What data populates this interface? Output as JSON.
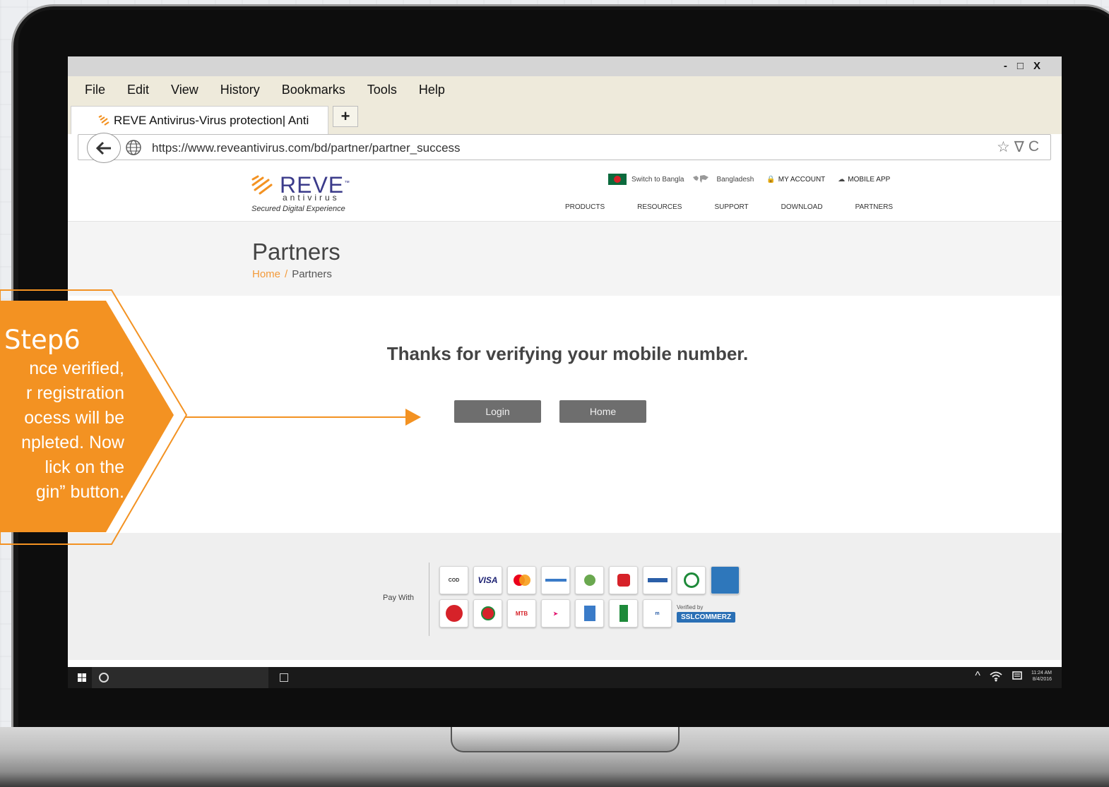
{
  "browser": {
    "window_controls": [
      "-",
      "□",
      "X"
    ],
    "menu": [
      "File",
      "Edit",
      "View",
      "History",
      "Bookmarks",
      "Tools",
      "Help"
    ],
    "tab_title": "REVE Antivirus-Virus protection| Anti",
    "new_tab": "+",
    "url": "https://www.reveantivirus.com/bd/partner/partner_success",
    "address_icons": [
      "☆",
      "∇",
      "C"
    ]
  },
  "site": {
    "logo": {
      "name": "REVE",
      "trademark": "™",
      "sub": "antivirus",
      "tagline": "Secured Digital Experience"
    },
    "topnav": {
      "switch_lang": "Switch to Bangla",
      "country": "Bangladesh",
      "account": "MY ACCOUNT",
      "mobile_app": "MOBILE APP"
    },
    "mainnav": [
      "PRODUCTS",
      "RESOURCES",
      "SUPPORT",
      "DOWNLOAD",
      "PARTNERS"
    ],
    "page_title": "Partners",
    "breadcrumb": {
      "home": "Home",
      "separator": "/",
      "current": "Partners"
    },
    "message": "Thanks for verifying your mobile number.",
    "buttons": {
      "login": "Login",
      "home": "Home"
    },
    "footer": {
      "pay_with": "Pay With",
      "ssl_verified": "Verified by",
      "ssl_name": "SSLCOMMERZ"
    }
  },
  "taskbar": {
    "time": "11:24 AM",
    "date": "8/4/2016"
  },
  "callout": {
    "title": "Step6",
    "lines": [
      "nce verified,",
      "r registration",
      "ocess will be",
      "npleted. Now",
      "lick on the",
      "gin” button."
    ]
  },
  "colors": {
    "accent": "#f39222",
    "button": "#6e6e6e",
    "logo": "#3b3b8a"
  }
}
